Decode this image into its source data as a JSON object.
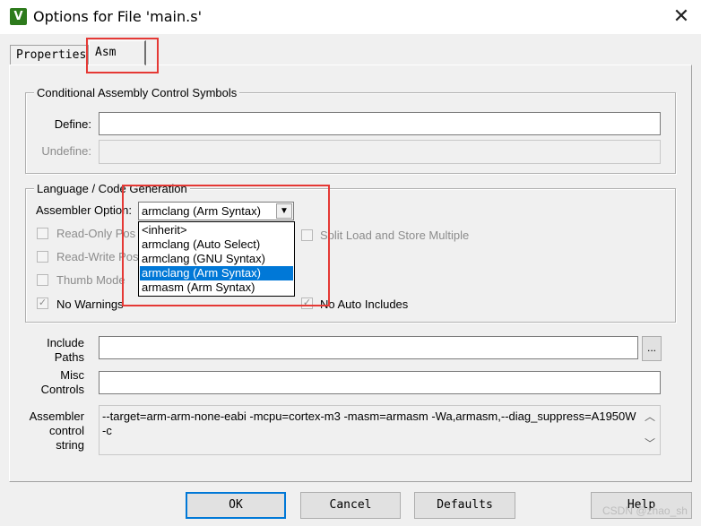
{
  "window": {
    "app_icon_glyph": "V",
    "title": "Options for File 'main.s'",
    "close_glyph": "✕"
  },
  "tabs": [
    {
      "label": "Properties",
      "selected": false
    },
    {
      "label": "Asm",
      "selected": true
    }
  ],
  "conditional_group": {
    "legend": "Conditional Assembly Control Symbols",
    "define_label": "Define:",
    "define_value": "",
    "undefine_label": "Undefine:",
    "undefine_value": ""
  },
  "language_group": {
    "legend": "Language / Code Generation",
    "assembler_option_label": "Assembler Option:",
    "assembler_option_value": "armclang (Arm Syntax)",
    "dropdown_options": [
      "<inherit>",
      "armclang (Auto Select)",
      "armclang (GNU Syntax)",
      "armclang (Arm Syntax)",
      "armasm (Arm Syntax)"
    ],
    "dropdown_selected_index": 3,
    "checkboxes_left": [
      {
        "label": "Read-Only Pos",
        "checked": false,
        "enabled": false
      },
      {
        "label": "Read-Write Pos",
        "checked": false,
        "enabled": false
      },
      {
        "label": "Thumb Mode",
        "checked": false,
        "enabled": false
      },
      {
        "label": "No Warnings",
        "checked": true,
        "enabled": true
      }
    ],
    "checkboxes_right": [
      {
        "label": "Split Load and Store Multiple",
        "checked": false,
        "enabled": false
      },
      {
        "label": "No Auto Includes",
        "checked": true,
        "enabled": true
      }
    ]
  },
  "include_paths": {
    "label_line1": "Include",
    "label_line2": "Paths",
    "value": "",
    "browse_label": "..."
  },
  "misc_controls": {
    "label_line1": "Misc",
    "label_line2": "Controls",
    "value": ""
  },
  "control_string": {
    "label_line1": "Assembler",
    "label_line2": "control",
    "label_line3": "string",
    "line1": "--target=arm-arm-none-eabi -mcpu=cortex-m3 -masm=armasm  -Wa,armasm,--diag_suppress=A1950W",
    "line2": "-c",
    "scroll_up": "︿",
    "scroll_down": "﹀"
  },
  "buttons": {
    "ok": "OK",
    "cancel": "Cancel",
    "defaults": "Defaults",
    "help": "Help"
  },
  "watermark": "CSDN @zhao_sh",
  "colors": {
    "selection": "#0078d7",
    "annotation_red": "#e53935"
  }
}
